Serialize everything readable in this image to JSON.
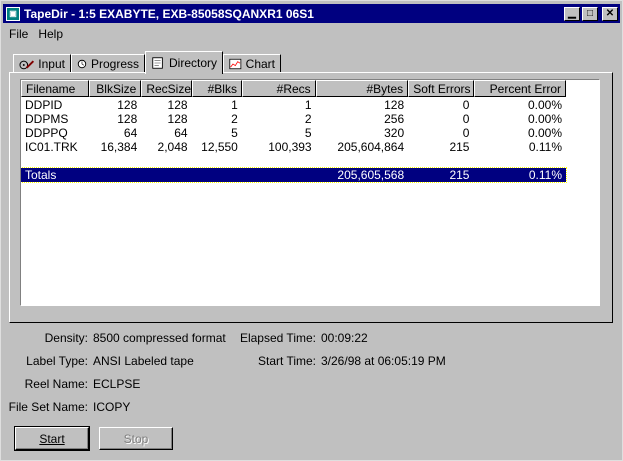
{
  "window": {
    "title": "TapeDir - 1:5 EXABYTE, EXB-85058SQANXR1 06S1"
  },
  "menu": {
    "file": "File",
    "help": "Help"
  },
  "tabs": [
    {
      "label": "Input",
      "icon": "tape-icon"
    },
    {
      "label": "Progress",
      "icon": "clock-icon"
    },
    {
      "label": "Directory",
      "icon": "document-icon",
      "active": true
    },
    {
      "label": "Chart",
      "icon": "chart-icon"
    }
  ],
  "table": {
    "columns": [
      "Filename",
      "BlkSize",
      "RecSize",
      "#Blks",
      "#Recs",
      "#Bytes",
      "Soft Errors",
      "Percent Error"
    ],
    "rows": [
      [
        "DDPID",
        "128",
        "128",
        "1",
        "1",
        "128",
        "0",
        "0.00%"
      ],
      [
        "DDPMS",
        "128",
        "128",
        "2",
        "2",
        "256",
        "0",
        "0.00%"
      ],
      [
        "DDPPQ",
        "64",
        "64",
        "5",
        "5",
        "320",
        "0",
        "0.00%"
      ],
      [
        "IC01.TRK",
        "16,384",
        "2,048",
        "12,550",
        "100,393",
        "205,604,864",
        "215",
        "0.11%"
      ]
    ],
    "totals": {
      "label": "Totals",
      "bytes": "205,605,568",
      "soft_errors": "215",
      "percent_error": "0.11%"
    }
  },
  "info": {
    "density_label": "Density:",
    "density_value": "8500 compressed format",
    "label_type_label": "Label Type:",
    "label_type_value": "ANSI Labeled tape",
    "reel_name_label": "Reel Name:",
    "reel_name_value": "ECLPSE",
    "file_set_label": "File Set Name:",
    "file_set_value": "ICOPY",
    "elapsed_label": "Elapsed Time:",
    "elapsed_value": "00:09:22",
    "start_label": "Start Time:",
    "start_value": "3/26/98 at 06:05:19 PM"
  },
  "buttons": {
    "start": "Start",
    "stop": "Stop"
  }
}
